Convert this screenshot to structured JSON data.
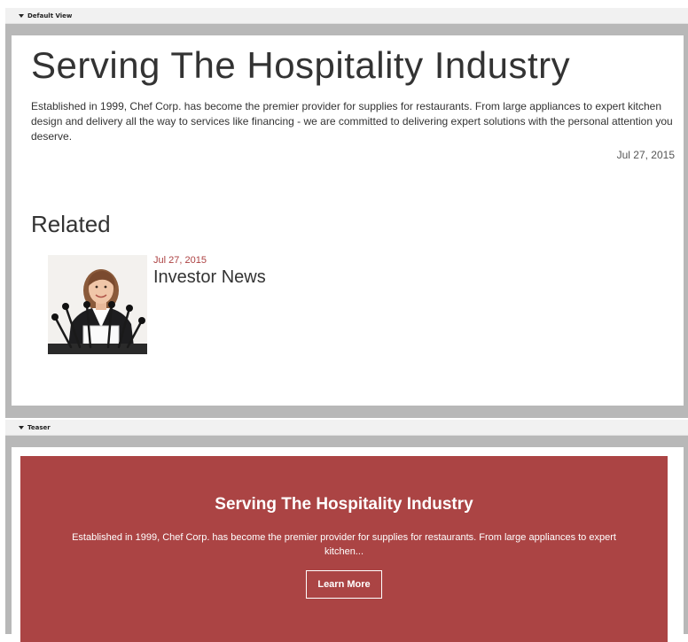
{
  "default_view": {
    "header_label": "Default View",
    "title": "Serving The Hospitality Industry",
    "body": "Established in 1999, Chef Corp. has become the premier provider for supplies for restaurants. From large appliances to expert kitchen design and delivery all the way to services like financing - we are committed to delivering expert solutions with the personal attention you deserve.",
    "date": "Jul 27, 2015",
    "related": {
      "heading": "Related",
      "items": [
        {
          "date": "Jul 27, 2015",
          "title": "Investor News"
        }
      ]
    }
  },
  "teaser": {
    "header_label": "Teaser",
    "title": "Serving The Hospitality Industry",
    "body": "Established in 1999, Chef Corp. has become the premier provider for supplies for restaurants. From large appliances to expert kitchen...",
    "button_label": "Learn More"
  },
  "colors": {
    "accent": "#ab4444",
    "frame_gray": "#b8b8b8",
    "header_bg": "#f1f1f1"
  },
  "icons": {
    "section_toggle": "caret-down-icon"
  }
}
